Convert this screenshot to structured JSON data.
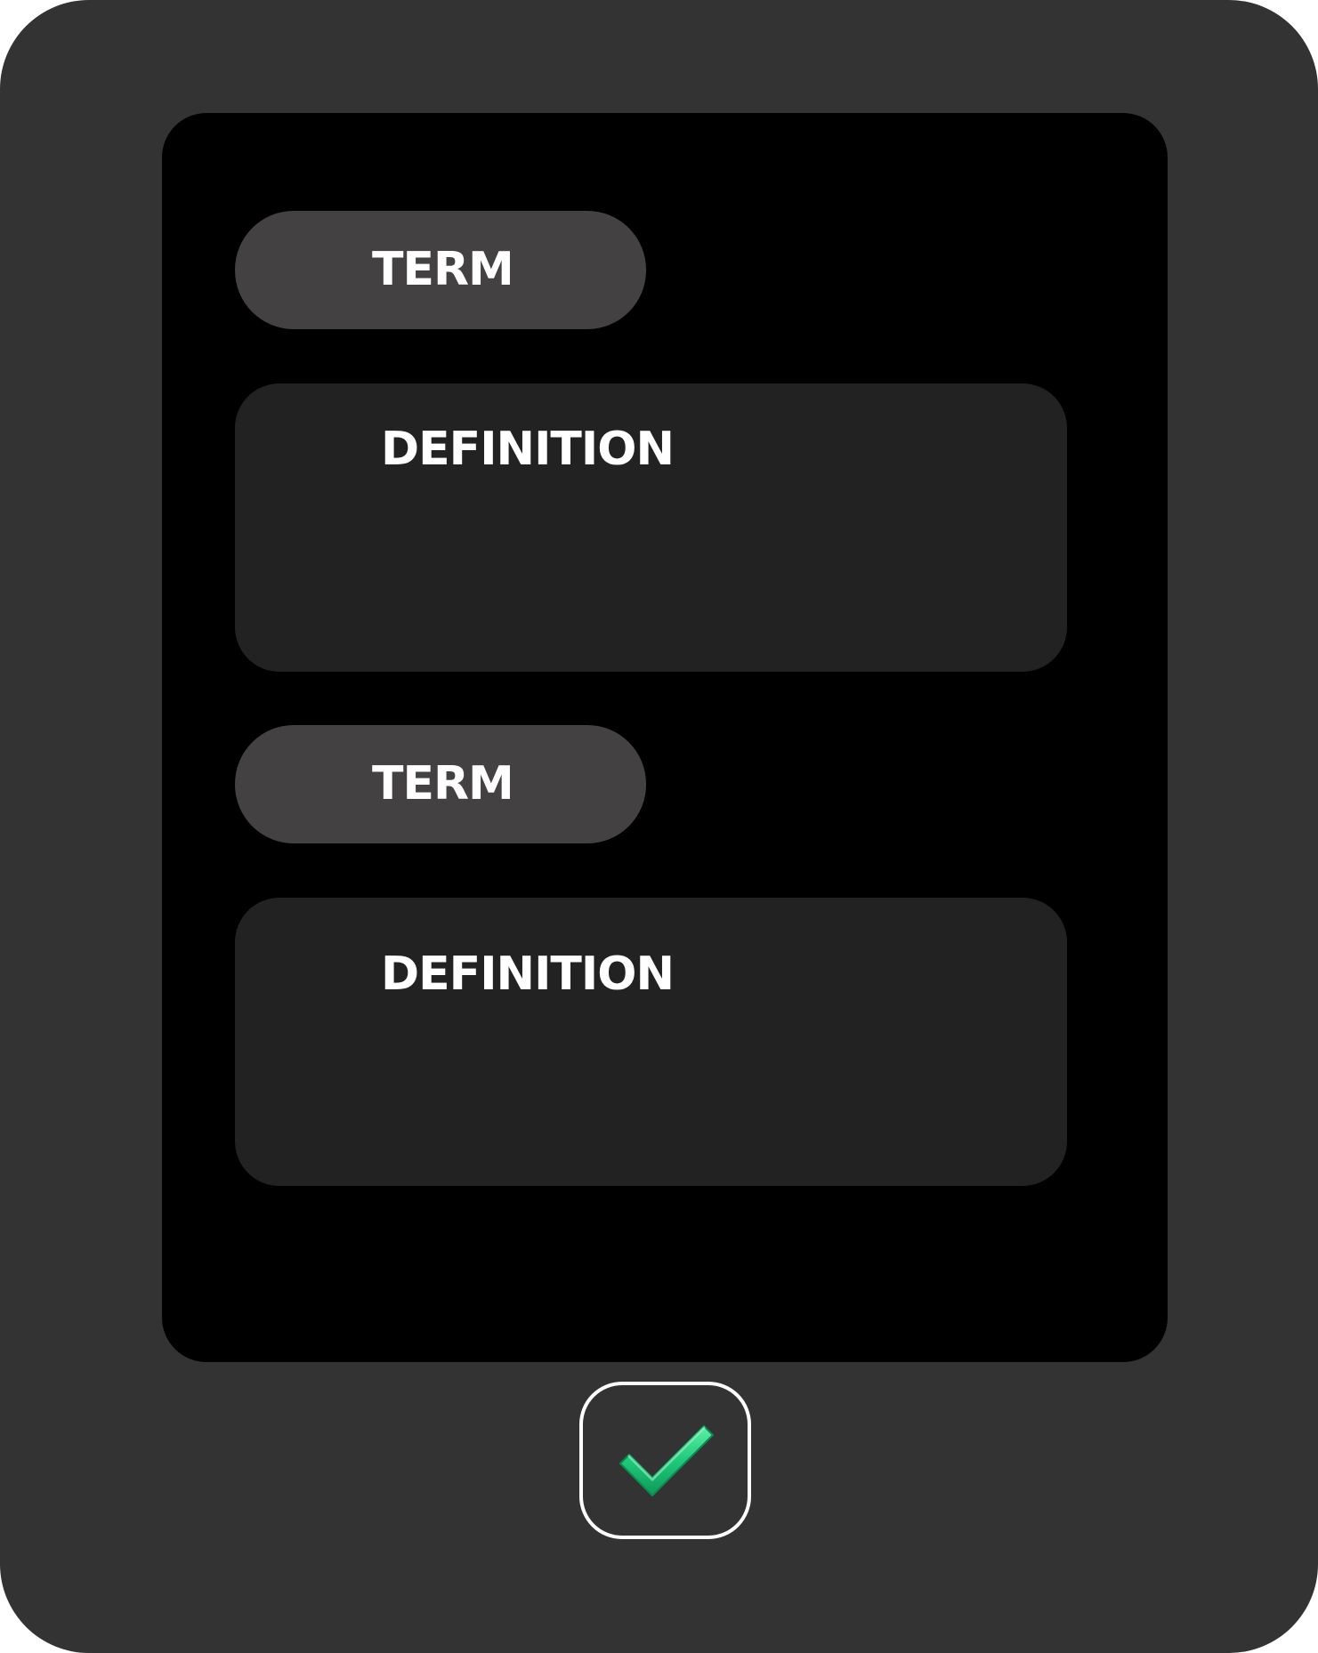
{
  "cards": [
    {
      "term": "TERM",
      "definition": "DEFINITION"
    },
    {
      "term": "TERM",
      "definition": "DEFINITION"
    }
  ],
  "submit": {
    "icon": "checkmark-icon"
  },
  "colors": {
    "device": "#333333",
    "screen": "#000000",
    "term_pill": "#434142",
    "definition_card": "#222222",
    "check_green": "#2ecc71",
    "text": "#ffffff"
  }
}
